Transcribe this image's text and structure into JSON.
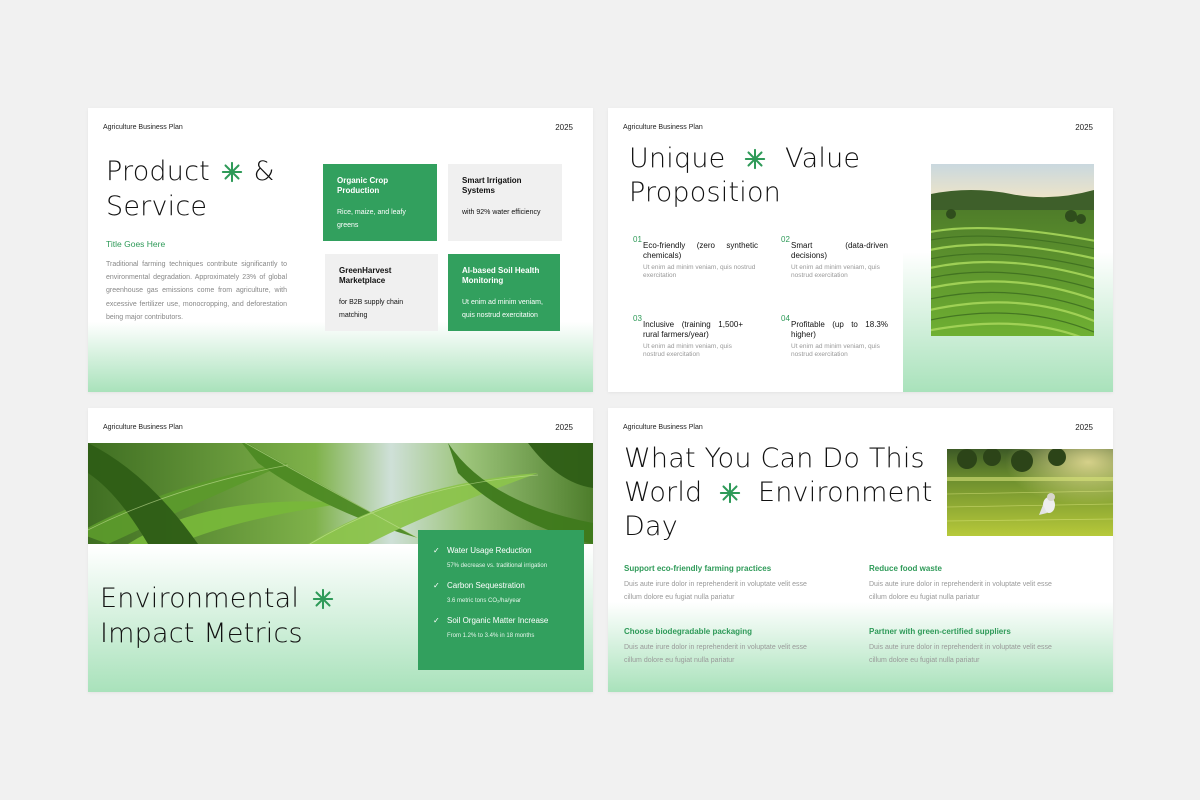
{
  "brand": "Agriculture Business Plan",
  "year": "2025",
  "slide1": {
    "title_line1": "Product",
    "title_and": "&",
    "title_line2": "Service",
    "subtitle": "Title Goes Here",
    "body": "Traditional farming techniques contribute significantly to environmental degradation. Approximately 23% of global greenhouse gas emissions come from agriculture, with excessive fertilizer use, monocropping, and deforestation being major contributors.",
    "cards": [
      {
        "title": "Organic Crop Production",
        "desc": "Rice, maize, and leafy greens"
      },
      {
        "title": "Smart Irrigation Systems",
        "desc": "with 92% water efficiency"
      },
      {
        "title": "GreenHarvest Marketplace",
        "desc": "for B2B supply chain matching"
      },
      {
        "title": "AI-based Soil Health Monitoring",
        "desc": "Ut enim ad minim veniam, quis nostrud exercitation"
      }
    ]
  },
  "slide2": {
    "title_w1": "Unique",
    "title_w2": "Value",
    "title_line2": "Proposition",
    "items": [
      {
        "num": "01",
        "title": "Eco-friendly (zero synthetic chemicals)",
        "desc": "Ut enim ad minim veniam, quis nostrud exercitation"
      },
      {
        "num": "02",
        "title": "Smart (data-driven decisions)",
        "desc": "Ut enim ad minim veniam, quis nostrud exercitation"
      },
      {
        "num": "03",
        "title": "Inclusive (training 1,500+ rural farmers/year)",
        "desc": "Ut enim ad minim veniam, quis nostrud exercitation"
      },
      {
        "num": "04",
        "title": "Profitable (up to 18.3% higher)",
        "desc": "Ut enim ad minim veniam, quis nostrud exercitation"
      }
    ]
  },
  "slide3": {
    "title_line1": "Environmental",
    "title_line2": "Impact Metrics",
    "metrics": [
      {
        "title": "Water Usage Reduction",
        "desc": "57% decrease vs. traditional irrigation"
      },
      {
        "title": "Carbon Sequestration",
        "desc": "3.6 metric tons CO₂/ha/year"
      },
      {
        "title": "Soil Organic Matter Increase",
        "desc": "From 1.2% to 3.4% in 18 months"
      }
    ]
  },
  "slide4": {
    "title_line1": "What You Can Do This",
    "title_line2a": "World",
    "title_line2b": "Environment",
    "title_line3": "Day",
    "tips": [
      {
        "title": "Support eco-friendly farming practices",
        "desc": "Duis aute irure dolor in reprehenderit in voluptate velit esse cillum dolore eu fugiat nulla pariatur"
      },
      {
        "title": "Reduce food waste",
        "desc": "Duis aute irure dolor in reprehenderit in voluptate velit esse cillum dolore eu fugiat nulla pariatur"
      },
      {
        "title": "Choose biodegradable packaging",
        "desc": "Duis aute irure dolor in reprehenderit in voluptate velit esse cillum dolore eu fugiat nulla pariatur"
      },
      {
        "title": "Partner with green-certified suppliers",
        "desc": "Duis aute irure dolor in reprehenderit in voluptate velit esse cillum dolore eu fugiat nulla pariatur"
      }
    ]
  },
  "icons": {
    "star": "asterisk-star-icon",
    "check": "check-icon"
  },
  "colors": {
    "accent": "#32a05e",
    "gradient": "#a9e2bb",
    "background": "#f1f1f1"
  }
}
